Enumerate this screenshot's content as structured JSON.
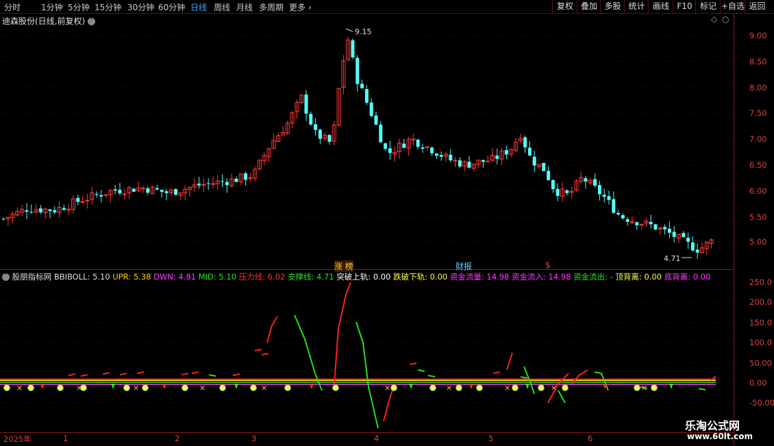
{
  "toolbar": {
    "timeframes": [
      "分时",
      "1分钟",
      "5分钟",
      "15分钟",
      "30分钟",
      "60分钟",
      "日线",
      "周线",
      "月线",
      "多周期",
      "更多"
    ],
    "active": "日线",
    "buttons": [
      "复权",
      "叠加",
      "多股",
      "统计",
      "画线",
      "F10",
      "标记",
      "+自选",
      "返回"
    ]
  },
  "main": {
    "title": "迪森股份(日线,前复权)",
    "y_ticks": [
      "9.00",
      "8.50",
      "8.00",
      "7.50",
      "7.00",
      "6.50",
      "6.00",
      "5.50",
      "5.00"
    ],
    "high_label": "9.15",
    "low_label": "4.71",
    "markers": {
      "zhangbang": "涨 榜",
      "caibao": "财报",
      "dollar": "$"
    }
  },
  "indicator": {
    "name": "股朋指标网",
    "items": [
      {
        "label": "BBIBOLL: 5.10",
        "color": "#dddddd"
      },
      {
        "label": "UPR: 5.38",
        "color": "#ffd000"
      },
      {
        "label": "DWN: 4.81",
        "color": "#ff40ff"
      },
      {
        "label": "MID: 5.10",
        "color": "#30e030"
      },
      {
        "label": "压力线: 6.02",
        "color": "#ff3030"
      },
      {
        "label": "支撑线: 4.71",
        "color": "#30e030"
      },
      {
        "label": "突破上轨: 0.00",
        "color": "#ffffff"
      },
      {
        "label": "跌破下轨: 0.00",
        "color": "#ffff40"
      },
      {
        "label": "资金流量: 14.98",
        "color": "#ff40ff"
      },
      {
        "label": "资金流入: 14.98",
        "color": "#ff40ff"
      },
      {
        "label": "资金流出: -",
        "color": "#30e030"
      },
      {
        "label": "顶背离: 0.00",
        "color": "#ffff40"
      },
      {
        "label": "底背离: 0.00",
        "color": "#ff40ff"
      }
    ],
    "y_ticks": [
      "250.0",
      "200.0",
      "150.0",
      "100.0",
      "50.00",
      "0.00",
      "-50.00"
    ]
  },
  "time_axis": [
    "2025年",
    "1",
    "2",
    "3",
    "4",
    "5",
    "6"
  ],
  "watermark": {
    "name": "乐淘公式网",
    "url": "www.60lt.com"
  },
  "colors": {
    "up": "#ff3b3b",
    "down": "#54ffff",
    "grid": "#8a1a1a"
  }
}
